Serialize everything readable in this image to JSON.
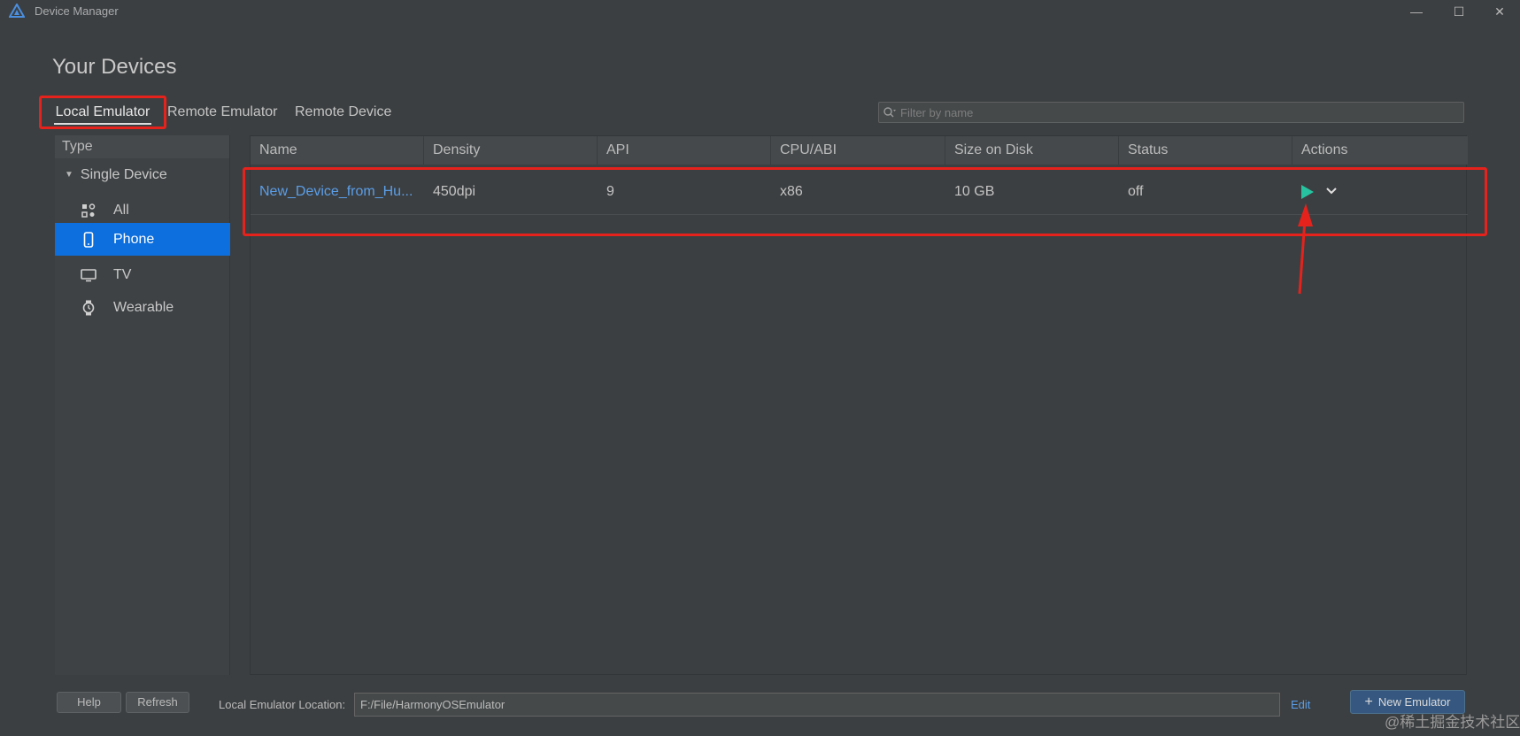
{
  "window": {
    "title": "Device Manager",
    "controls": [
      "—",
      "☐",
      "✕"
    ]
  },
  "page": {
    "title": "Your Devices"
  },
  "tabs": [
    {
      "label": "Local Emulator",
      "selected": true
    },
    {
      "label": "Remote Emulator",
      "selected": false
    },
    {
      "label": "Remote Device",
      "selected": false
    }
  ],
  "filter": {
    "placeholder": "Filter by name",
    "value": ""
  },
  "sidebar": {
    "header": "Type",
    "group": "Single Device",
    "items": [
      {
        "label": "All",
        "icon": "all-icon",
        "selected": false
      },
      {
        "label": "Phone",
        "icon": "phone-icon",
        "selected": true
      },
      {
        "label": "TV",
        "icon": "tv-icon",
        "selected": false
      },
      {
        "label": "Wearable",
        "icon": "watch-icon",
        "selected": false
      }
    ]
  },
  "table": {
    "columns": [
      "Name",
      "Density",
      "API",
      "CPU/ABI",
      "Size on Disk",
      "Status",
      "Actions"
    ],
    "rows": [
      {
        "name": "New_Device_from_Hu...",
        "density": "450dpi",
        "api": "9",
        "cpu": "x86",
        "size": "10 GB",
        "status": "off",
        "actions": [
          "play-icon",
          "chevron-down-icon"
        ]
      }
    ]
  },
  "footer": {
    "help_label": "Help",
    "refresh_label": "Refresh",
    "location_label": "Local Emulator Location:",
    "location_value": "F:/File/HarmonyOSEmulator",
    "edit_label": "Edit",
    "new_emulator_label": "New Emulator"
  },
  "watermark": "@稀土掘金技术社区",
  "colors": {
    "background": "#3c3f41",
    "selected": "#0d6fdd",
    "link": "#5a9ee8",
    "play": "#27c3a0",
    "annotation": "#e6221c"
  }
}
